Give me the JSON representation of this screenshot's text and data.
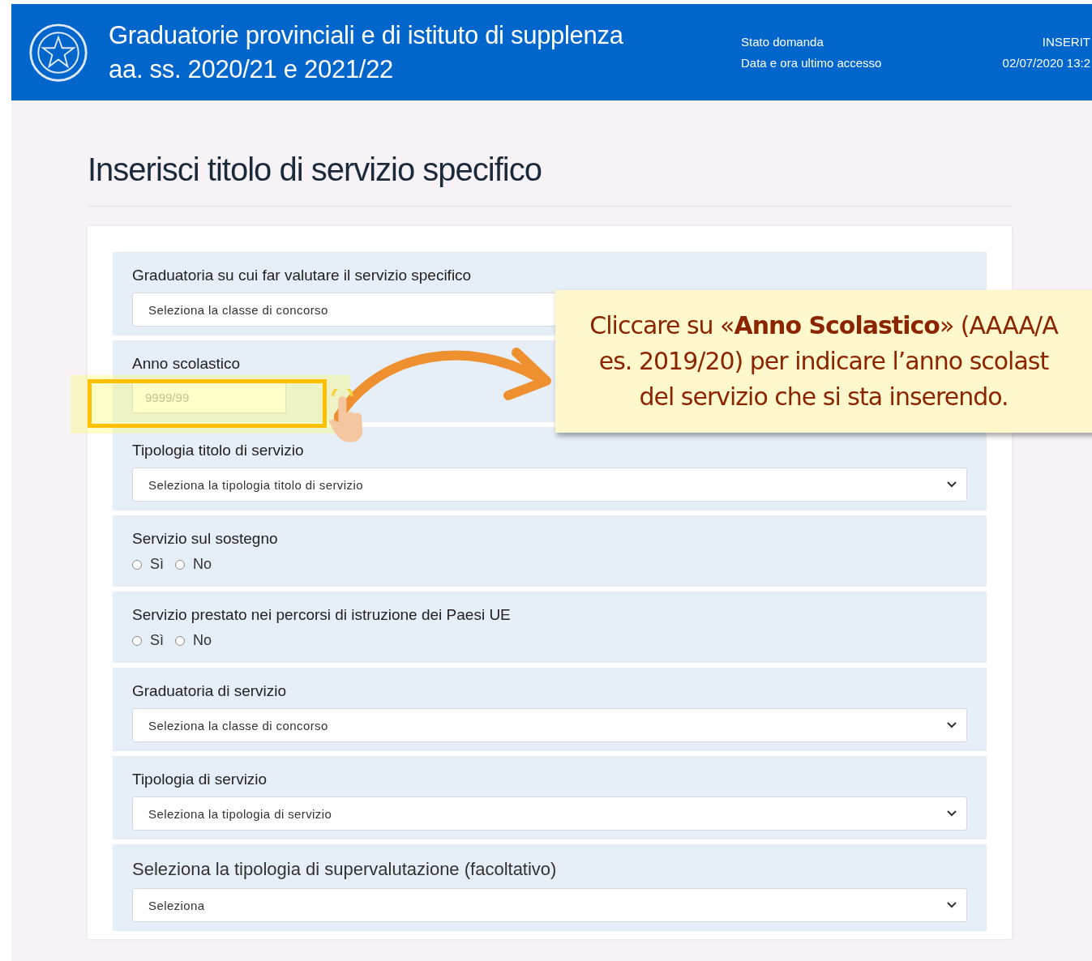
{
  "header": {
    "title_lines": [
      "Graduatorie provinciali e di istituto di supplenza",
      "aa. ss. 2020/21 e 2021/22"
    ],
    "info": [
      {
        "label": "Stato domanda",
        "value": "INSERIT"
      },
      {
        "label": "Data e ora ultimo accesso",
        "value": "02/07/2020 13:2"
      }
    ]
  },
  "page_title": "Inserisci titolo di servizio specifico",
  "sections": [
    {
      "kind": "select",
      "label": "Graduatoria su cui far valutare il servizio specifico",
      "placeholder": "Seleziona la classe di concorso"
    },
    {
      "kind": "input",
      "label": "Anno scolastico",
      "placeholder": "9999/99"
    },
    {
      "kind": "select",
      "label": "Tipologia titolo di servizio",
      "placeholder": "Seleziona la tipologia titolo di servizio"
    },
    {
      "kind": "radio",
      "label": "Servizio sul sostegno",
      "options": [
        {
          "label": "Sì",
          "selected": false
        },
        {
          "label": "No",
          "selected": false
        }
      ]
    },
    {
      "kind": "radio",
      "label": "Servizio prestato nei percorsi di istruzione dei Paesi UE",
      "options": [
        {
          "label": "Sì",
          "selected": false
        },
        {
          "label": "No",
          "selected": false
        }
      ]
    },
    {
      "kind": "select",
      "label": "Graduatoria di servizio",
      "placeholder": "Seleziona la classe di concorso"
    },
    {
      "kind": "select",
      "label": "Tipologia di servizio",
      "placeholder": "Seleziona la tipologia di servizio"
    },
    {
      "kind": "select",
      "label": "Seleziona la tipologia di supervalutazione (facoltativo)",
      "placeholder": "Seleziona"
    }
  ],
  "callout": {
    "text": "Cliccare su «**Anno Scolastico**» (AAAA/A\nes. 2019/20) per indicare l’anno scolast\ndel servizio che si sta inserendo."
  }
}
